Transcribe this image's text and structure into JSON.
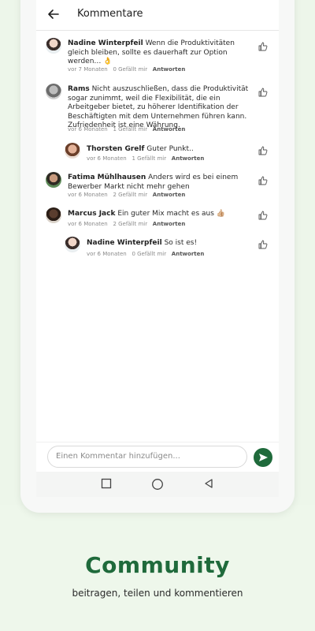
{
  "colors": {
    "accent": "#1f6a3b",
    "background": "#edf6ea"
  },
  "appbar": {
    "title": "Kommentare",
    "back_icon": "arrow-left-icon"
  },
  "comments": [
    {
      "author": "Nadine Winterpfeil",
      "text": "Wenn die Produktivitäten gleich bleiben, sollte es dauerhaft zur Option werden… 👌",
      "time": "vor 7 Monaten",
      "likes": "0 Gefällt mir",
      "reply": "Antworten",
      "reply_to": false
    },
    {
      "author": "Rams",
      "text": "Nicht auszuschließen, dass die Produktivität sogar zunimmt, weil die Flexibilität, die ein Arbeitgeber bietet, zu höherer Identifikation der Beschäftigten mit dem Unternehmen führen kann. Zufriedenheit ist eine Währung.",
      "time": "vor 6 Monaten",
      "likes": "1 Gefällt mir",
      "reply": "Antworten",
      "reply_to": false
    },
    {
      "author": "Thorsten Grelf",
      "text": "Guter Punkt..",
      "time": "vor 6 Monaten",
      "likes": "1 Gefällt mir",
      "reply": "Antworten",
      "reply_to": true
    },
    {
      "author": "Fatima Mühlhausen",
      "text": "Anders wird es bei einem Bewerber Markt nicht mehr gehen",
      "time": "vor 6 Monaten",
      "likes": "2 Gefällt mir",
      "reply": "Antworten",
      "reply_to": false
    },
    {
      "author": "Marcus Jack",
      "text": "Ein guter Mix macht es aus 👍🏼",
      "time": "vor 6 Monaten",
      "likes": "2 Gefällt mir",
      "reply": "Antworten",
      "reply_to": false
    },
    {
      "author": "Nadine Winterpfeil",
      "text": "So ist es!",
      "time": "vor 6 Monaten",
      "likes": "0 Gefällt mir",
      "reply": "Antworten",
      "reply_to": true
    }
  ],
  "input": {
    "placeholder": "Einen Kommentar hinzufügen..."
  },
  "promo": {
    "headline": "Community",
    "subline": "beitragen, teilen und kommentieren"
  }
}
